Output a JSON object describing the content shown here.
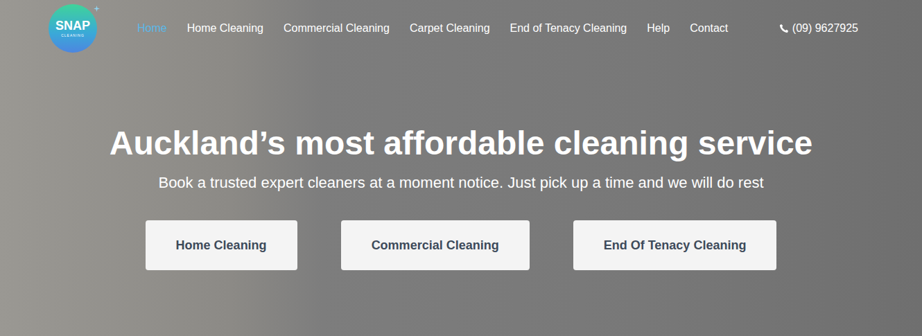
{
  "logo": {
    "title": "SNAP",
    "subtitle": "CLEANING"
  },
  "nav": {
    "items": [
      {
        "label": "Home",
        "selected": true
      },
      {
        "label": "Home Cleaning",
        "selected": false
      },
      {
        "label": "Commercial Cleaning",
        "selected": false
      },
      {
        "label": "Carpet Cleaning",
        "selected": false
      },
      {
        "label": "End of Tenacy Cleaning",
        "selected": false
      },
      {
        "label": "Help",
        "selected": false
      },
      {
        "label": "Contact",
        "selected": false
      }
    ],
    "phone": "(09) 9627925"
  },
  "hero": {
    "title": "Auckland’s most affordable cleaning service",
    "subtitle": "Book a trusted expert cleaners at a moment notice. Just pick up a time and we will do rest",
    "buttons": [
      "Home Cleaning",
      "Commercial Cleaning",
      "End Of Tenacy Cleaning"
    ]
  }
}
